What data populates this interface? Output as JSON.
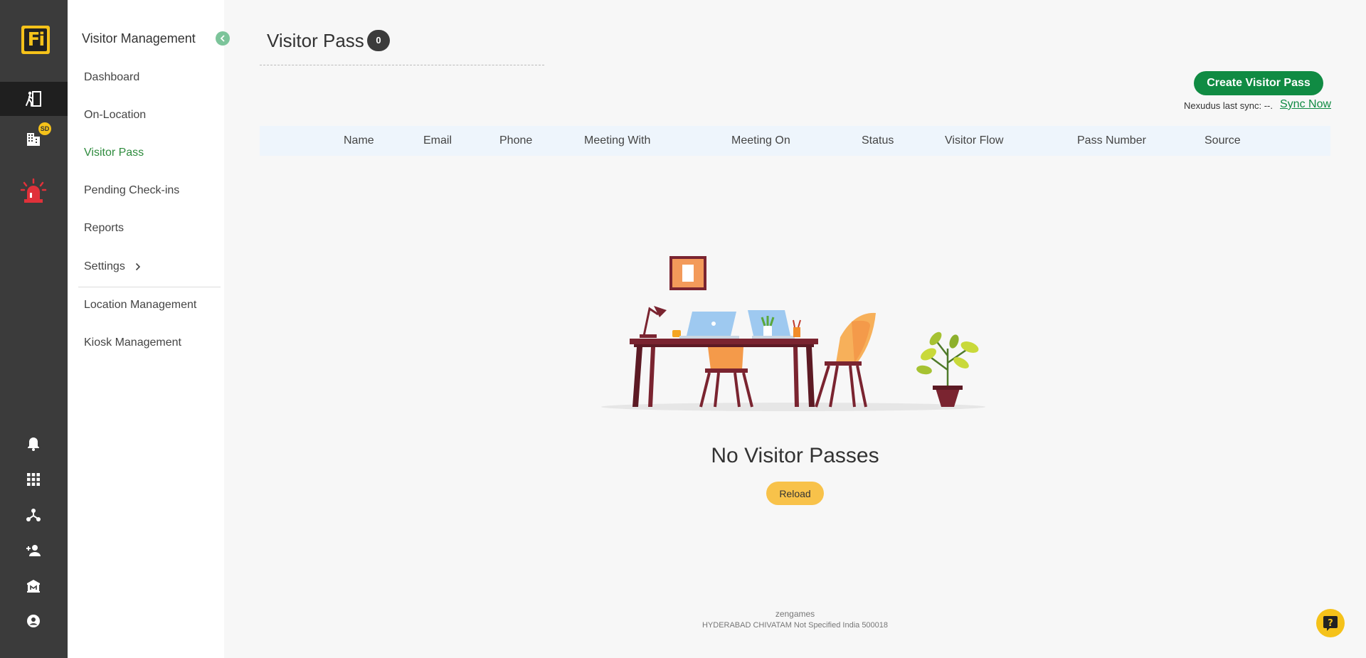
{
  "app": {
    "logo_text": "Fi"
  },
  "rail": {
    "top_items": [
      {
        "icon": "visitor-walk-icon",
        "active": true
      },
      {
        "icon": "building-icon",
        "badge": "SD"
      },
      {
        "icon": "emergency-alarm-icon"
      }
    ],
    "bottom_items": [
      {
        "icon": "bell-icon"
      },
      {
        "icon": "apps-grid-icon"
      },
      {
        "icon": "network-icon"
      },
      {
        "icon": "add-person-icon"
      },
      {
        "icon": "bank-icon"
      },
      {
        "icon": "account-circle-icon"
      }
    ]
  },
  "subnav": {
    "title": "Visitor Management",
    "items": [
      {
        "label": "Dashboard"
      },
      {
        "label": "On-Location"
      },
      {
        "label": "Visitor Pass",
        "active": true
      },
      {
        "label": "Pending Check-ins"
      },
      {
        "label": "Reports"
      },
      {
        "label": "Settings"
      },
      {
        "label": "Location Management"
      },
      {
        "label": "Kiosk Management"
      }
    ]
  },
  "page": {
    "title": "Visitor Pass",
    "count": "0",
    "create_button": "Create Visitor Pass",
    "sync_text": "Nexudus last sync: --.",
    "sync_link": "Sync Now"
  },
  "table": {
    "columns": [
      "Name",
      "Email",
      "Phone",
      "Meeting With",
      "Meeting On",
      "Status",
      "Visitor Flow",
      "Pass Number",
      "Source"
    ]
  },
  "empty_state": {
    "title": "No Visitor Passes",
    "reload_button": "Reload"
  },
  "footer": {
    "org": "zengames",
    "address": "HYDERABAD CHIVATAM Not Specified India 500018"
  },
  "colors": {
    "rail_bg": "#3b3b3b",
    "brand_yellow": "#f5c21a",
    "primary_green": "#108b43",
    "active_nav_green": "#2e8b3d",
    "reload_yellow": "#f8c24a",
    "alarm_red": "#e0313a"
  }
}
